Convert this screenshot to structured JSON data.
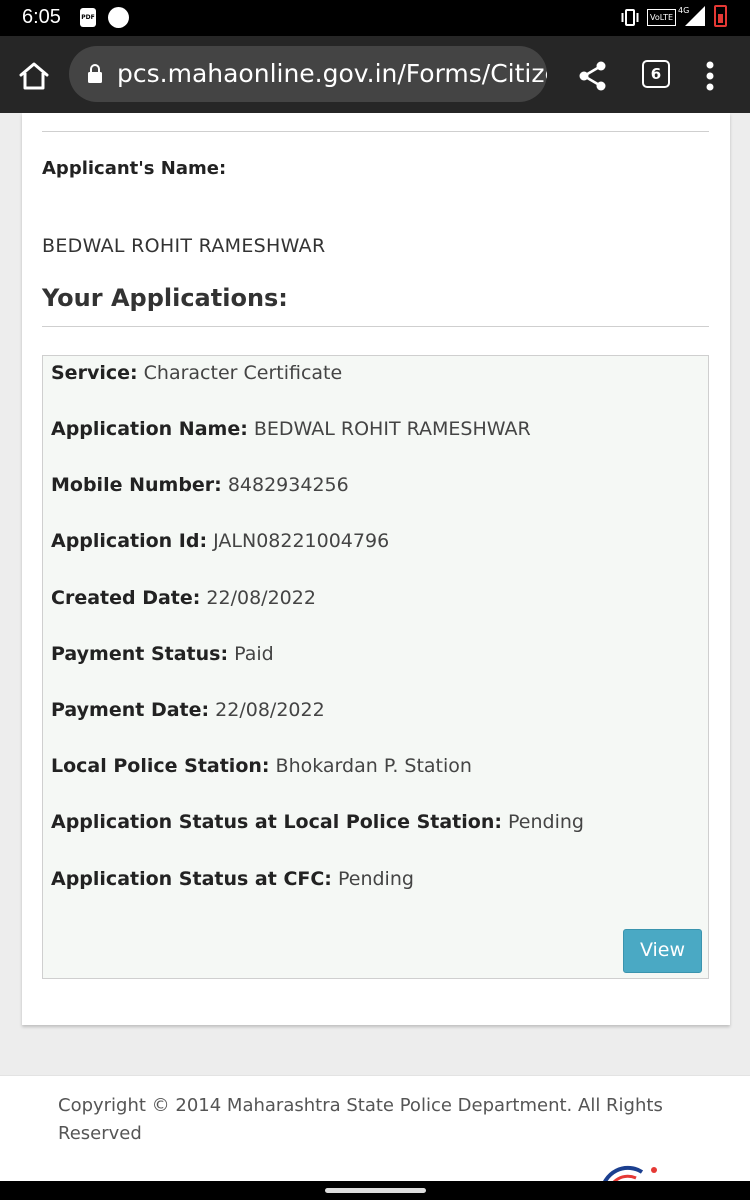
{
  "status_bar": {
    "time": "6:05",
    "pdf_badge": "PDF",
    "network_label": "VoLTE",
    "network_type": "4G"
  },
  "browser": {
    "url": "pcs.mahaonline.gov.in/Forms/CitizenHome",
    "tab_count": "6"
  },
  "profile": {
    "applicant_label": "Applicant's Name:",
    "applicant_name": "BEDWAL ROHIT RAMESHWAR",
    "applications_heading": "Your Applications:"
  },
  "application": {
    "fields": [
      {
        "label": "Service:",
        "value": "Character Certificate"
      },
      {
        "label": "Application Name:",
        "value": "BEDWAL ROHIT RAMESHWAR"
      },
      {
        "label": "Mobile Number:",
        "value": "8482934256"
      },
      {
        "label": "Application Id:",
        "value": "JALN08221004796"
      },
      {
        "label": "Created Date:",
        "value": "22/08/2022"
      },
      {
        "label": "Payment Status:",
        "value": "Paid"
      },
      {
        "label": "Payment Date:",
        "value": "22/08/2022"
      },
      {
        "label": "Local Police Station:",
        "value": "Bhokardan P. Station"
      },
      {
        "label": "Application Status at Local Police Station:",
        "value": "Pending"
      },
      {
        "label": "Application Status at CFC:",
        "value": "Pending"
      }
    ],
    "view_button": "View"
  },
  "footer": {
    "copyright": "Copyright © 2014 Maharashtra State Police Department. All Rights Reserved"
  },
  "colors": {
    "view_button": "#4aa9c4",
    "browser_bar": "#262626",
    "url_pill": "#444444"
  },
  "icons": [
    "home-icon",
    "lock-icon",
    "share-icon",
    "tabs-icon",
    "more-vert-icon",
    "vibrate-icon",
    "signal-icon",
    "battery-icon"
  ]
}
